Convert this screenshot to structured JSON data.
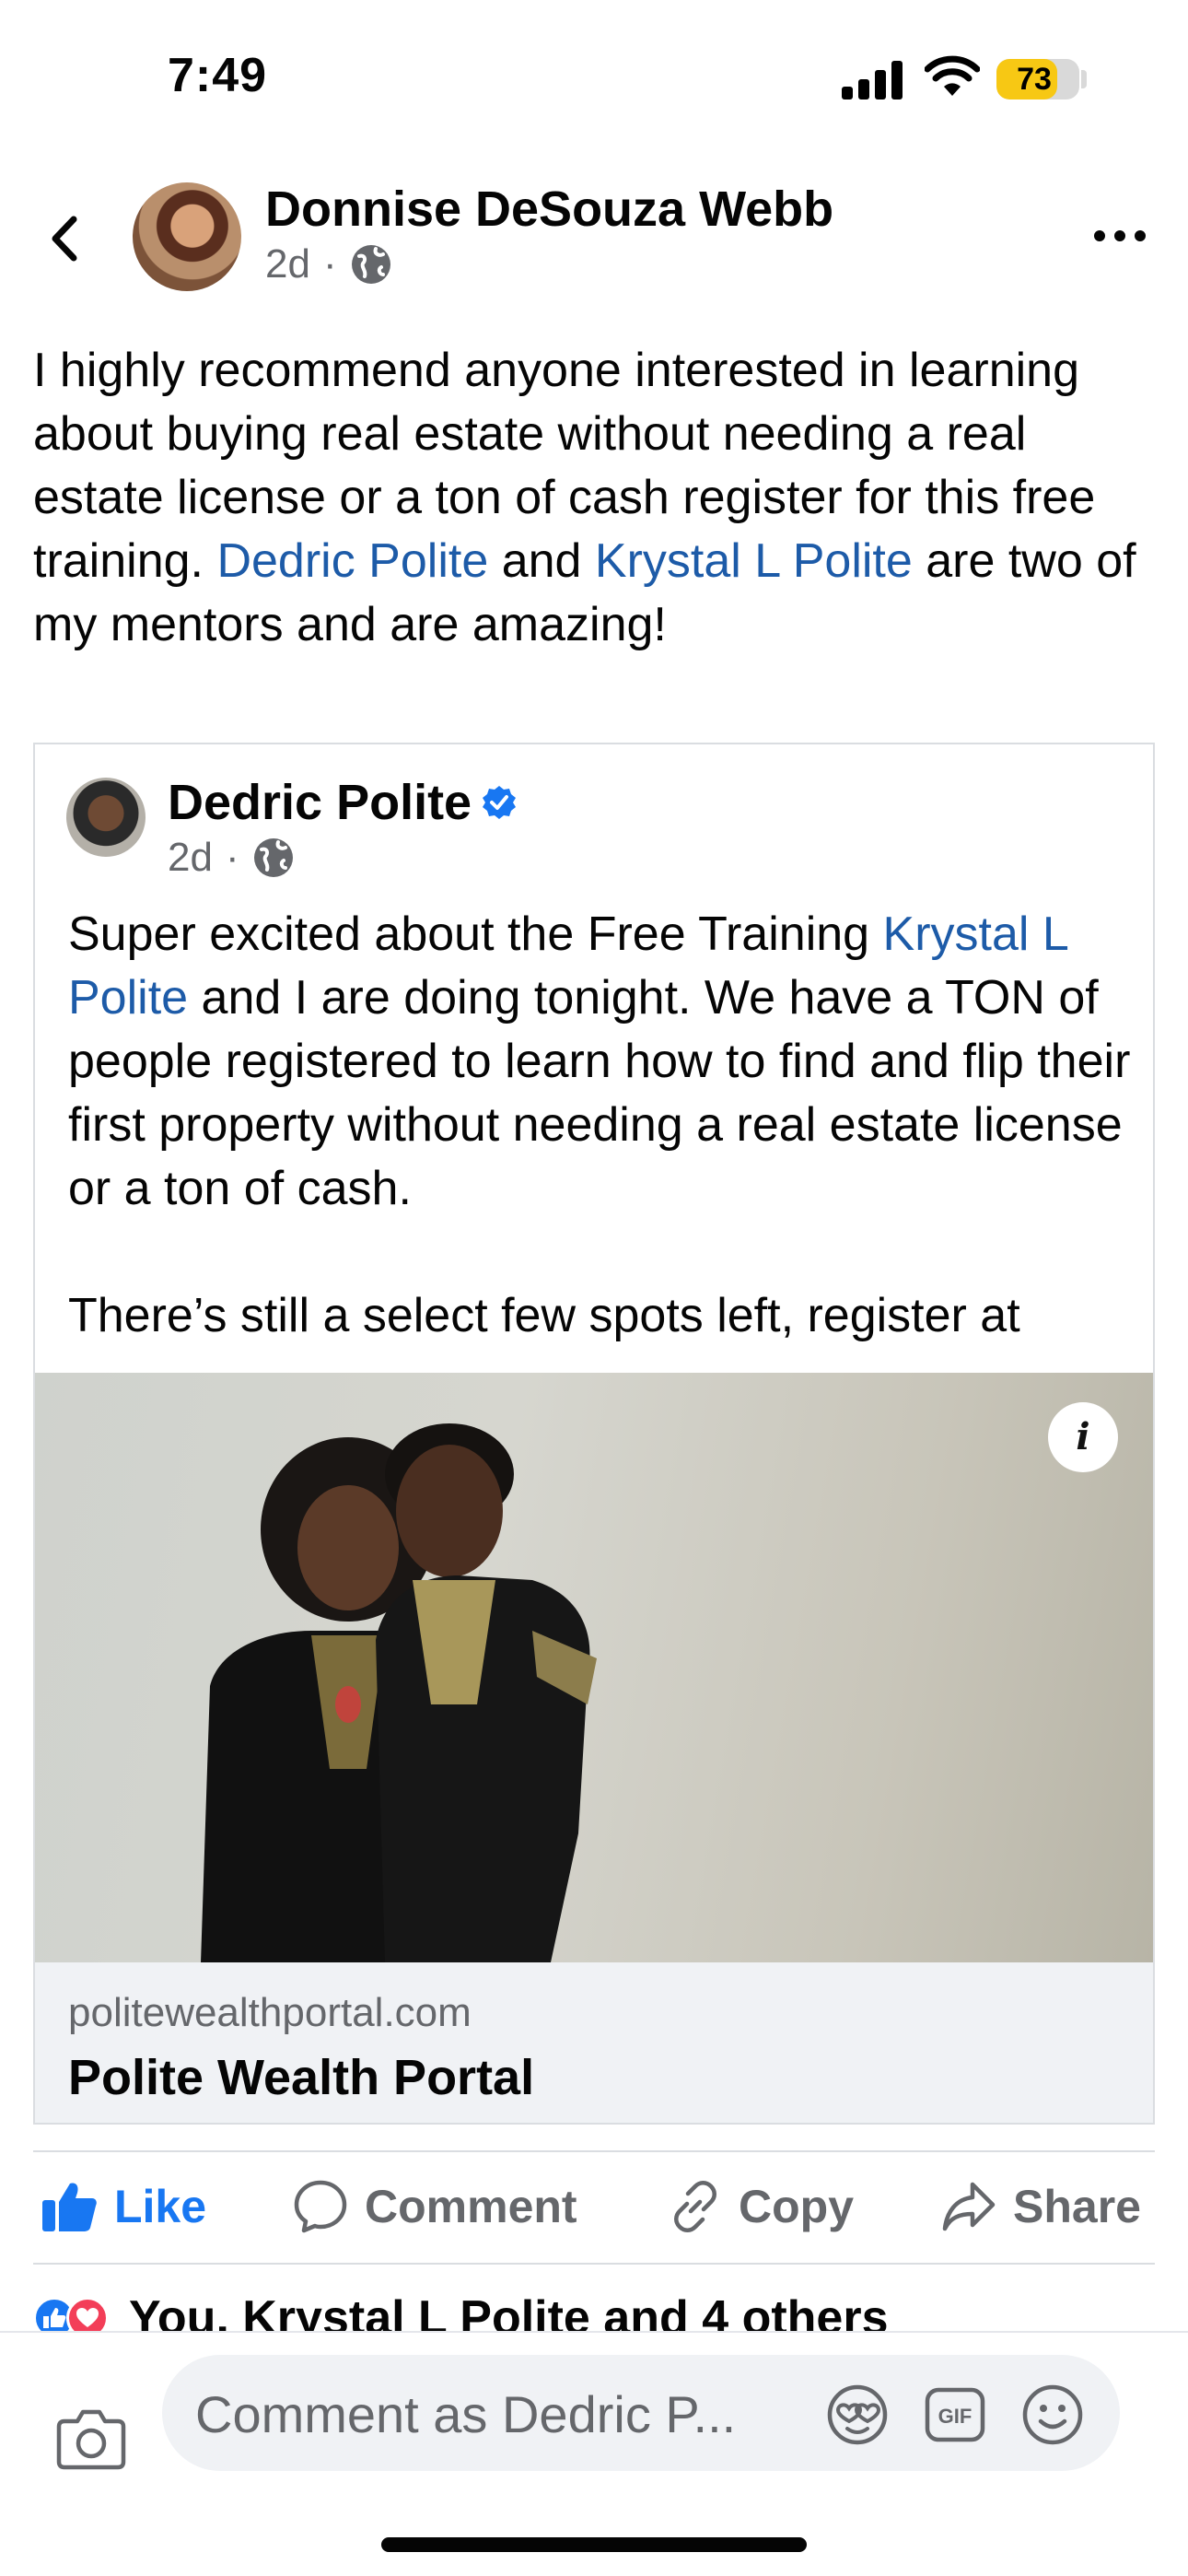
{
  "status_bar": {
    "time": "7:49",
    "battery": "73",
    "battery_level": 0.73
  },
  "post": {
    "author": "Donnise DeSouza Webb",
    "time": "2d",
    "separator": "·",
    "text_parts": [
      "I highly recommend anyone interested in learning about buying real estate without needing a real estate license or a ton of cash register for this free training. ",
      "Dedric Polite",
      " and ",
      "Krystal L Polite",
      " are two of my mentors and are amazing!"
    ]
  },
  "shared_post": {
    "author": "Dedric Polite",
    "time": "2d",
    "separator": "·",
    "text_parts": [
      "Super excited about the Free Training ",
      "Krystal L Polite",
      " and I are doing tonight. We have a TON of people registered to learn how to find and flip their first property without needing a real estate license or a ton of cash.\n\nThere’s still a select few spots left, register at"
    ],
    "info_button": "i",
    "link_preview": {
      "domain": "politewealthportal.com",
      "title": "Polite Wealth Portal"
    }
  },
  "actions": {
    "like": "Like",
    "comment": "Comment",
    "copy": "Copy",
    "share": "Share"
  },
  "reactions": {
    "summary": "You, Krystal L Polite and 4 others"
  },
  "comment_bar": {
    "placeholder": "Comment as Dedric P..."
  },
  "colors": {
    "link": "#1d5ba8",
    "accent": "#1877f2",
    "muted": "#65676b",
    "battery": "#f7c814"
  },
  "icons": [
    "back-chevron-icon",
    "globe-icon",
    "more-icon",
    "verified-badge-icon",
    "info-icon",
    "like-thumb-icon",
    "comment-bubble-icon",
    "link-icon",
    "share-arrow-icon",
    "like-reaction-icon",
    "love-reaction-icon",
    "camera-icon",
    "avatar-sticker-icon",
    "gif-icon",
    "emoji-icon"
  ]
}
